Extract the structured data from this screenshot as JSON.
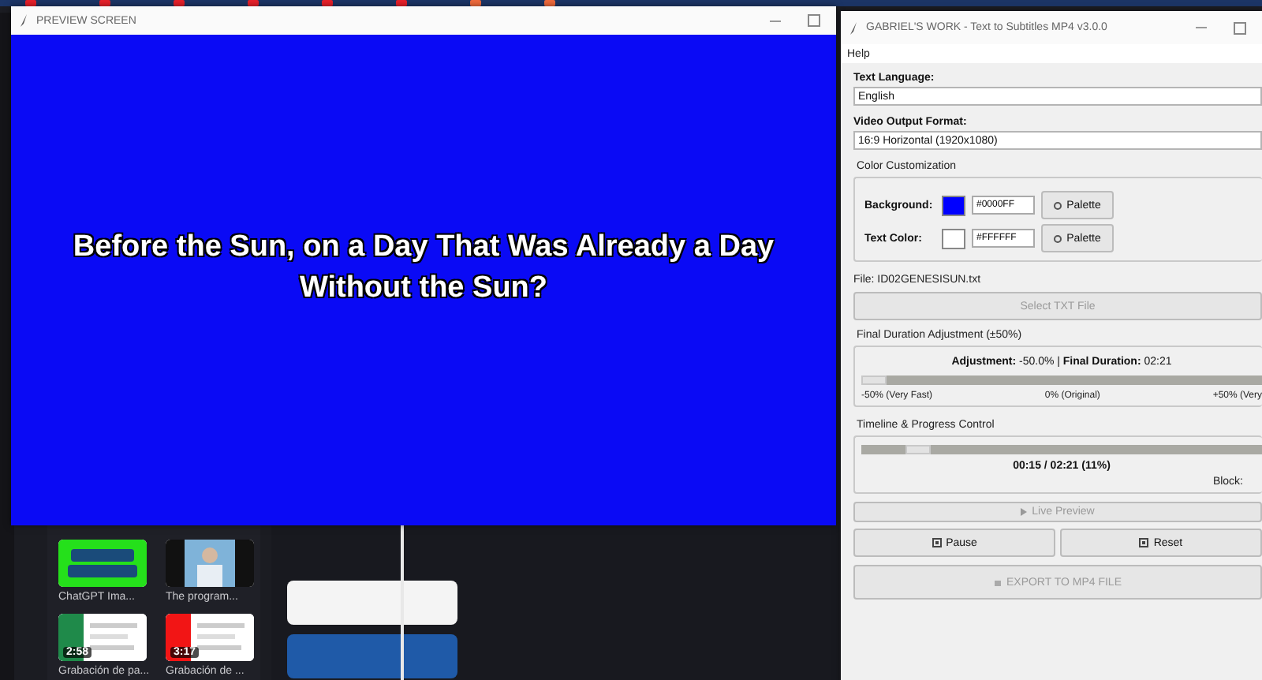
{
  "preview_window": {
    "title": "PREVIEW SCREEN",
    "caption": "Before the Sun, on a Day That Was Already a Day Without the Sun?"
  },
  "editor": {
    "media": [
      {
        "title": "ChatGPT Ima...",
        "kind": "logo"
      },
      {
        "title": "The program...",
        "kind": "person"
      },
      {
        "title": "Grabación de pa...",
        "kind": "screen",
        "duration": "2:58"
      },
      {
        "title": "Grabación de ...",
        "kind": "screenred",
        "duration": "3:17"
      }
    ]
  },
  "app_window": {
    "title": "GABRIEL'S WORK - Text to Subtitles MP4 v3.0.0",
    "menu": [
      "Help"
    ],
    "text_language": {
      "label": "Text Language:",
      "value": "English"
    },
    "video_format": {
      "label": "Video Output Format:",
      "value": "16:9 Horizontal (1920x1080)"
    },
    "color_group": {
      "title": "Color Customization",
      "rows": [
        {
          "label": "Background:",
          "color": "#0000ff",
          "hex": "#0000FF",
          "button": "Palette"
        },
        {
          "label": "Text Color:",
          "color": "#ffffff",
          "hex": "#FFFFFF",
          "button": "Palette"
        }
      ]
    },
    "file": "File: ID02GENESISUN.txt",
    "select_button": {
      "label": "Select TXT File",
      "disabled": true
    },
    "duration_group": {
      "title": "Final Duration Adjustment (±50%)",
      "summary": "**Adjustment:** -50.0%  |  **Final Duration:** 02:21",
      "level": 0.0,
      "ticks": [
        "-50% (Very Fast)",
        "0% (Original)",
        "+50% (Very"
      ]
    },
    "timeline_group": {
      "title": "Timeline & Progress Control",
      "level": 0.11,
      "time": "00:15 / 02:21 (11%)",
      "block": "Block:"
    },
    "live_preview": {
      "label": "Live Preview",
      "disabled": true
    },
    "controls": [
      {
        "label": "Pause",
        "disabled": false
      },
      {
        "label": "Reset",
        "disabled": false
      }
    ],
    "export_button": {
      "label": "EXPORT TO MP4 FILE",
      "disabled": true
    }
  }
}
